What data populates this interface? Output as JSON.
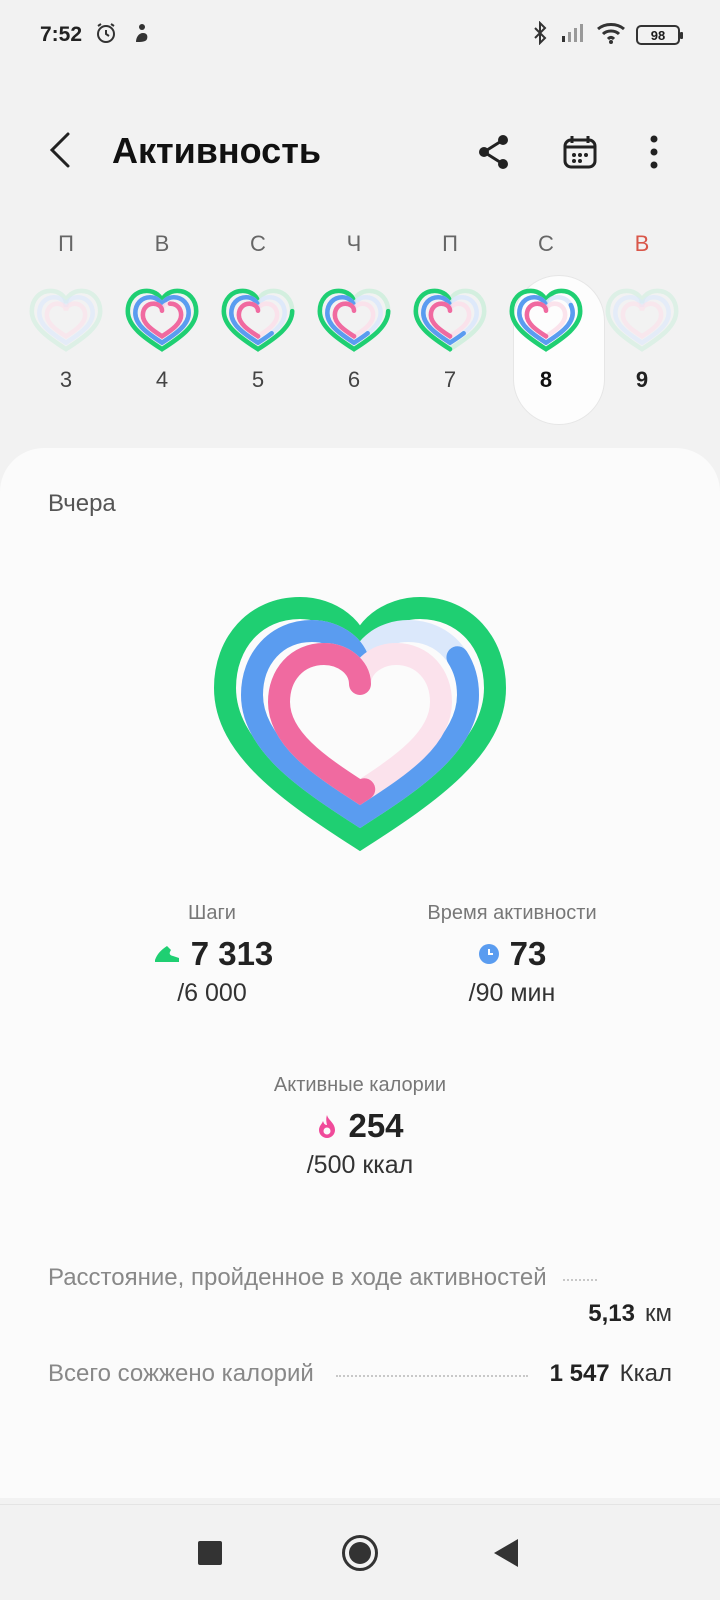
{
  "status_bar": {
    "time": "7:52",
    "battery": "98",
    "icons": [
      "alarm-icon",
      "notification-icon",
      "bluetooth-icon",
      "signal-icon",
      "wifi-icon",
      "battery-icon"
    ]
  },
  "app_bar": {
    "title": "Активность"
  },
  "week": {
    "days": [
      {
        "letter": "П",
        "num": "3",
        "state": "faint"
      },
      {
        "letter": "В",
        "num": "4",
        "state": "full"
      },
      {
        "letter": "С",
        "num": "5",
        "state": "partial"
      },
      {
        "letter": "Ч",
        "num": "6",
        "state": "partial"
      },
      {
        "letter": "П",
        "num": "7",
        "state": "partial-faint"
      },
      {
        "letter": "С",
        "num": "8",
        "state": "selected"
      },
      {
        "letter": "В",
        "num": "9",
        "state": "faint"
      }
    ],
    "selected_index": 5
  },
  "summary": {
    "date_label": "Вчера",
    "steps": {
      "label": "Шаги",
      "value": "7 313",
      "goal": "/6 000",
      "progress": 1.22
    },
    "active_time": {
      "label": "Время активности",
      "value": "73",
      "goal": "/90 мин",
      "progress": 0.81
    },
    "calories": {
      "label": "Активные калории",
      "value": "254",
      "goal": "/500 ккал",
      "progress": 0.51
    }
  },
  "details": {
    "distance": {
      "label": "Расстояние, пройденное в ходе активностей",
      "value": "5,13",
      "unit": "км"
    },
    "total_calories": {
      "label": "Всего сожжено калорий",
      "value": "1 547",
      "unit": "Ккал"
    }
  },
  "colors": {
    "steps": "#1fcf72",
    "active_time": "#5a9cf0",
    "calories": "#f06aa0",
    "sunday": "#d9574a"
  }
}
